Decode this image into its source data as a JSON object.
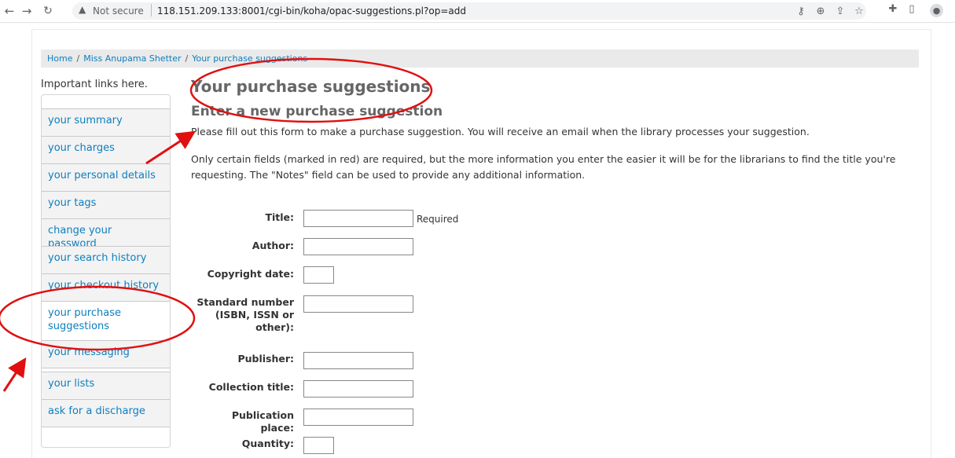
{
  "browser": {
    "security_label": "Not secure",
    "url": "118.151.209.133:8001/cgi-bin/koha/opac-suggestions.pl?op=add",
    "icons": [
      "back-icon",
      "forward-icon",
      "reload-icon",
      "warning-icon",
      "key-icon",
      "zoom-icon",
      "share-icon",
      "star-icon",
      "extensions-icon",
      "sidepanel-icon",
      "profile-icon"
    ]
  },
  "breadcrumb": {
    "home": "Home",
    "user": "Miss Anupama Shetter",
    "current": "Your purchase suggestions",
    "separator": "/"
  },
  "sidebar": {
    "heading": "Important links here.",
    "items": [
      {
        "label": "your summary"
      },
      {
        "label": "your charges"
      },
      {
        "label": "your personal details"
      },
      {
        "label": "your tags"
      },
      {
        "label": "change your password"
      },
      {
        "label": "your search history"
      },
      {
        "label": "your checkout history"
      },
      {
        "label": "your purchase suggestions"
      },
      {
        "label": "your messaging"
      },
      {
        "label": "your lists"
      },
      {
        "label": "ask for a discharge"
      }
    ]
  },
  "main": {
    "title": "Your purchase suggestions",
    "subtitle": "Enter a new purchase suggestion",
    "intro": "Please fill out this form to make a purchase suggestion. You will receive an email when the library processes your suggestion.",
    "note": "Only certain fields (marked in red) are required, but the more information you enter the easier it will be for the librarians to find the title you're requesting. The \"Notes\" field can be used to provide any additional information."
  },
  "form": {
    "title_label": "Title:",
    "title_value": "",
    "required_text": "Required",
    "author_label": "Author:",
    "author_value": "",
    "copyright_label": "Copyright date:",
    "copyright_value": "",
    "standard_label": "Standard number (ISBN, ISSN or other):",
    "standard_value": "",
    "publisher_label": "Publisher:",
    "publisher_value": "",
    "collection_label": "Collection title:",
    "collection_value": "",
    "place_label": "Publication place:",
    "place_value": "",
    "quantity_label": "Quantity:",
    "quantity_value": ""
  },
  "colors": {
    "link": "#0c7fbf",
    "annotation": "#e01010",
    "breadcrumb_bg": "#eaeaea"
  }
}
